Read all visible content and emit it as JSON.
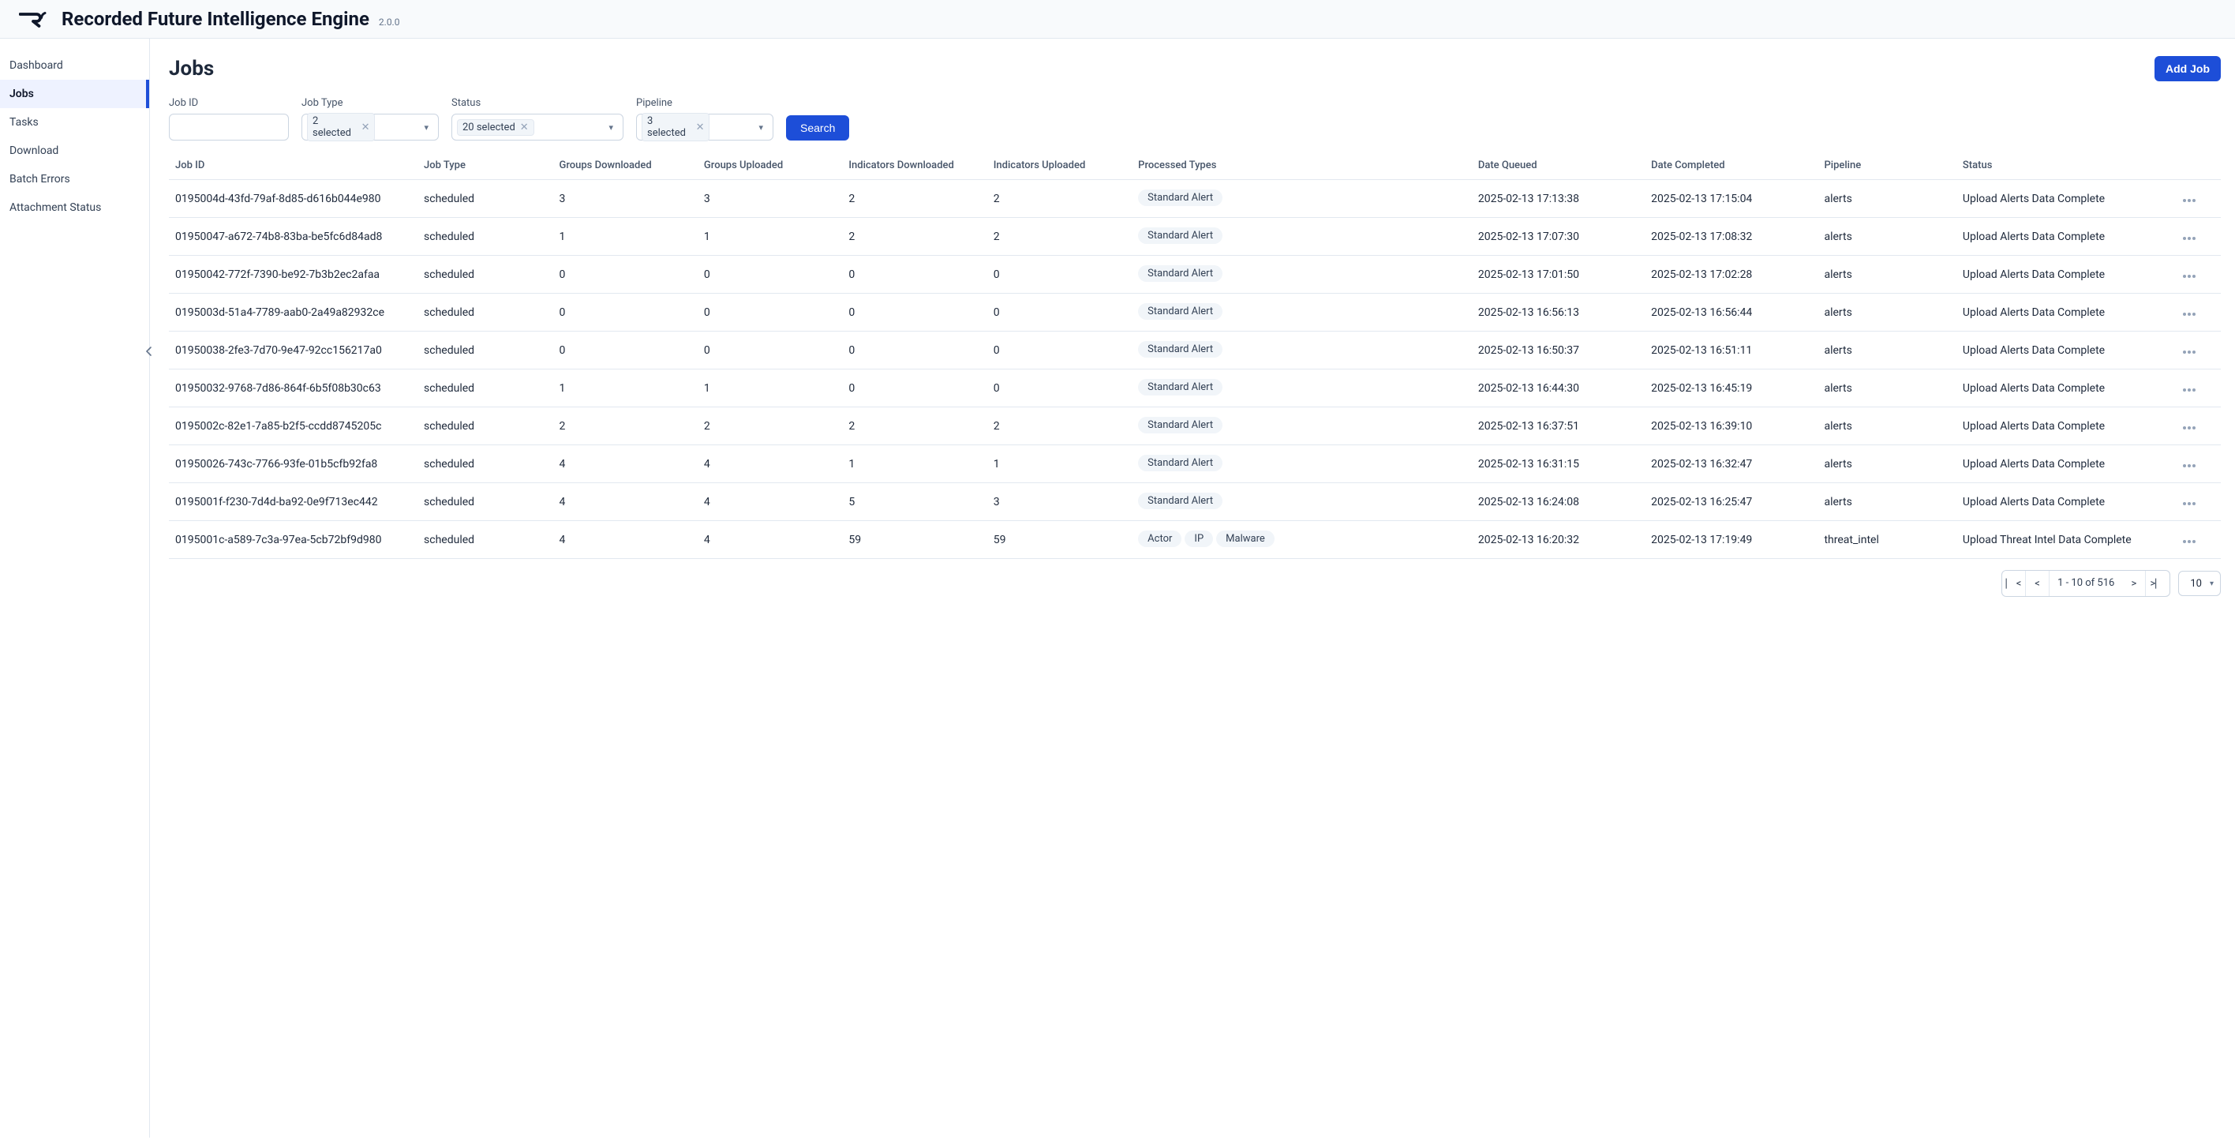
{
  "header": {
    "title": "Recorded Future Intelligence Engine",
    "version": "2.0.0"
  },
  "sidebar": {
    "items": [
      {
        "label": "Dashboard"
      },
      {
        "label": "Jobs"
      },
      {
        "label": "Tasks"
      },
      {
        "label": "Download"
      },
      {
        "label": "Batch Errors"
      },
      {
        "label": "Attachment Status"
      }
    ],
    "active_index": 1
  },
  "page": {
    "title": "Jobs",
    "add_button": "Add Job",
    "search_button": "Search"
  },
  "filters": {
    "job_id": {
      "label": "Job ID",
      "value": ""
    },
    "job_type": {
      "label": "Job Type",
      "chip": "2 selected"
    },
    "status": {
      "label": "Status",
      "chip": "20 selected"
    },
    "pipeline": {
      "label": "Pipeline",
      "chip": "3 selected"
    }
  },
  "columns": [
    "Job ID",
    "Job Type",
    "Groups Downloaded",
    "Groups Uploaded",
    "Indicators Downloaded",
    "Indicators Uploaded",
    "Processed Types",
    "Date Queued",
    "Date Completed",
    "Pipeline",
    "Status"
  ],
  "rows": [
    {
      "job_id": "0195004d-43fd-79af-8d85-d616b044e980",
      "job_type": "scheduled",
      "gd": "3",
      "gu": "3",
      "idl": "2",
      "iul": "2",
      "ptypes": [
        "Standard Alert"
      ],
      "queued": "2025-02-13 17:13:38",
      "completed": "2025-02-13 17:15:04",
      "pipeline": "alerts",
      "status": "Upload Alerts Data Complete"
    },
    {
      "job_id": "01950047-a672-74b8-83ba-be5fc6d84ad8",
      "job_type": "scheduled",
      "gd": "1",
      "gu": "1",
      "idl": "2",
      "iul": "2",
      "ptypes": [
        "Standard Alert"
      ],
      "queued": "2025-02-13 17:07:30",
      "completed": "2025-02-13 17:08:32",
      "pipeline": "alerts",
      "status": "Upload Alerts Data Complete"
    },
    {
      "job_id": "01950042-772f-7390-be92-7b3b2ec2afaa",
      "job_type": "scheduled",
      "gd": "0",
      "gu": "0",
      "idl": "0",
      "iul": "0",
      "ptypes": [
        "Standard Alert"
      ],
      "queued": "2025-02-13 17:01:50",
      "completed": "2025-02-13 17:02:28",
      "pipeline": "alerts",
      "status": "Upload Alerts Data Complete"
    },
    {
      "job_id": "0195003d-51a4-7789-aab0-2a49a82932ce",
      "job_type": "scheduled",
      "gd": "0",
      "gu": "0",
      "idl": "0",
      "iul": "0",
      "ptypes": [
        "Standard Alert"
      ],
      "queued": "2025-02-13 16:56:13",
      "completed": "2025-02-13 16:56:44",
      "pipeline": "alerts",
      "status": "Upload Alerts Data Complete"
    },
    {
      "job_id": "01950038-2fe3-7d70-9e47-92cc156217a0",
      "job_type": "scheduled",
      "gd": "0",
      "gu": "0",
      "idl": "0",
      "iul": "0",
      "ptypes": [
        "Standard Alert"
      ],
      "queued": "2025-02-13 16:50:37",
      "completed": "2025-02-13 16:51:11",
      "pipeline": "alerts",
      "status": "Upload Alerts Data Complete"
    },
    {
      "job_id": "01950032-9768-7d86-864f-6b5f08b30c63",
      "job_type": "scheduled",
      "gd": "1",
      "gu": "1",
      "idl": "0",
      "iul": "0",
      "ptypes": [
        "Standard Alert"
      ],
      "queued": "2025-02-13 16:44:30",
      "completed": "2025-02-13 16:45:19",
      "pipeline": "alerts",
      "status": "Upload Alerts Data Complete"
    },
    {
      "job_id": "0195002c-82e1-7a85-b2f5-ccdd8745205c",
      "job_type": "scheduled",
      "gd": "2",
      "gu": "2",
      "idl": "2",
      "iul": "2",
      "ptypes": [
        "Standard Alert"
      ],
      "queued": "2025-02-13 16:37:51",
      "completed": "2025-02-13 16:39:10",
      "pipeline": "alerts",
      "status": "Upload Alerts Data Complete"
    },
    {
      "job_id": "01950026-743c-7766-93fe-01b5cfb92fa8",
      "job_type": "scheduled",
      "gd": "4",
      "gu": "4",
      "idl": "1",
      "iul": "1",
      "ptypes": [
        "Standard Alert"
      ],
      "queued": "2025-02-13 16:31:15",
      "completed": "2025-02-13 16:32:47",
      "pipeline": "alerts",
      "status": "Upload Alerts Data Complete"
    },
    {
      "job_id": "0195001f-f230-7d4d-ba92-0e9f713ec442",
      "job_type": "scheduled",
      "gd": "4",
      "gu": "4",
      "idl": "5",
      "iul": "3",
      "ptypes": [
        "Standard Alert"
      ],
      "queued": "2025-02-13 16:24:08",
      "completed": "2025-02-13 16:25:47",
      "pipeline": "alerts",
      "status": "Upload Alerts Data Complete"
    },
    {
      "job_id": "0195001c-a589-7c3a-97ea-5cb72bf9d980",
      "job_type": "scheduled",
      "gd": "4",
      "gu": "4",
      "idl": "59",
      "iul": "59",
      "ptypes": [
        "Actor",
        "IP",
        "Malware"
      ],
      "queued": "2025-02-13 16:20:32",
      "completed": "2025-02-13 17:19:49",
      "pipeline": "threat_intel",
      "status": "Upload Threat Intel Data Complete"
    }
  ],
  "pagination": {
    "range_text": "1 - 10 of 516",
    "page_size": "10"
  }
}
